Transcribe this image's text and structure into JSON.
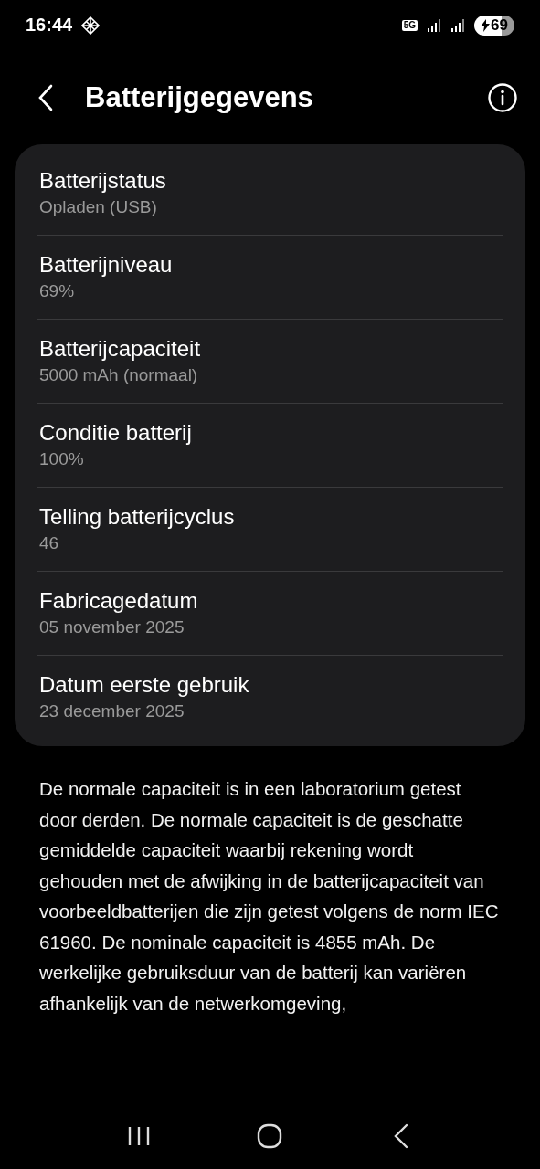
{
  "status_bar": {
    "time": "16:44",
    "network": "5G",
    "battery": "69",
    "charging": true
  },
  "header": {
    "title": "Batterijgegevens"
  },
  "items": [
    {
      "title": "Batterijstatus",
      "value": "Opladen (USB)"
    },
    {
      "title": "Batterijniveau",
      "value": "69%"
    },
    {
      "title": "Batterijcapaciteit",
      "value": "5000 mAh (normaal)"
    },
    {
      "title": "Conditie batterij",
      "value": "100%"
    },
    {
      "title": "Telling batterijcyclus",
      "value": "46"
    },
    {
      "title": "Fabricagedatum",
      "value": "05 november 2025"
    },
    {
      "title": "Datum eerste gebruik",
      "value": "23 december 2025"
    }
  ],
  "description": "De normale capaciteit is in een laboratorium getest door derden. De normale capaciteit is de geschatte gemiddelde capaciteit waarbij rekening wordt gehouden met de afwijking in de batterijcapaciteit van voorbeeldbatterijen die zijn getest volgens de norm IEC 61960. De nominale capaciteit is 4855 mAh. De werkelijke gebruiksduur van de batterij kan variëren afhankelijk van de netwerkomgeving,"
}
